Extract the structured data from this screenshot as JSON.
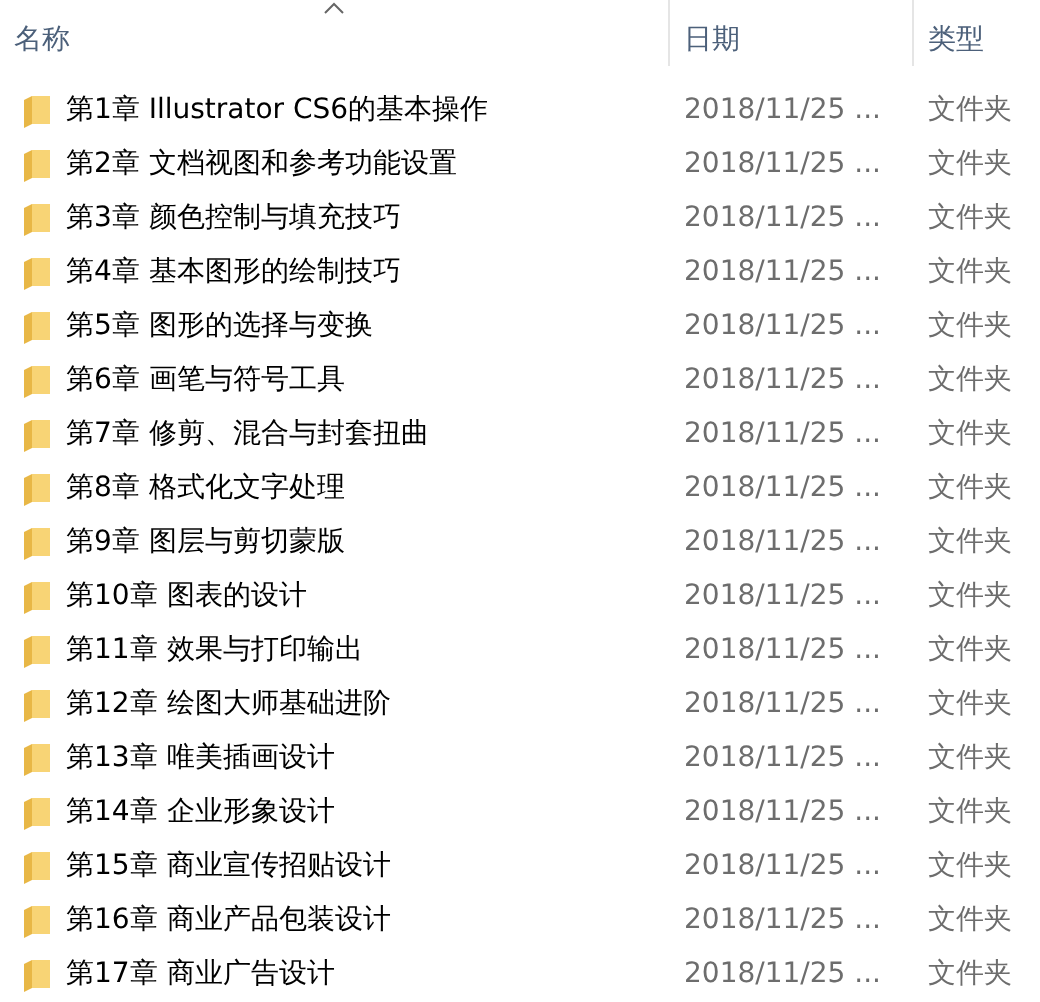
{
  "columns": [
    {
      "label": "名称",
      "sorted": true
    },
    {
      "label": "日期",
      "sorted": false
    },
    {
      "label": "类型",
      "sorted": false
    }
  ],
  "rows": [
    {
      "name": "第1章 Illustrator CS6的基本操作",
      "date": "2018/11/25 ...",
      "type": "文件夹"
    },
    {
      "name": "第2章 文档视图和参考功能设置",
      "date": "2018/11/25 ...",
      "type": "文件夹"
    },
    {
      "name": "第3章 颜色控制与填充技巧",
      "date": "2018/11/25 ...",
      "type": "文件夹"
    },
    {
      "name": "第4章 基本图形的绘制技巧",
      "date": "2018/11/25 ...",
      "type": "文件夹"
    },
    {
      "name": "第5章 图形的选择与变换",
      "date": "2018/11/25 ...",
      "type": "文件夹"
    },
    {
      "name": "第6章 画笔与符号工具",
      "date": "2018/11/25 ...",
      "type": "文件夹"
    },
    {
      "name": "第7章 修剪、混合与封套扭曲",
      "date": "2018/11/25 ...",
      "type": "文件夹"
    },
    {
      "name": "第8章 格式化文字处理",
      "date": "2018/11/25 ...",
      "type": "文件夹"
    },
    {
      "name": "第9章 图层与剪切蒙版",
      "date": "2018/11/25 ...",
      "type": "文件夹"
    },
    {
      "name": "第10章 图表的设计",
      "date": "2018/11/25 ...",
      "type": "文件夹"
    },
    {
      "name": "第11章 效果与打印输出",
      "date": "2018/11/25 ...",
      "type": "文件夹"
    },
    {
      "name": "第12章 绘图大师基础进阶",
      "date": "2018/11/25 ...",
      "type": "文件夹"
    },
    {
      "name": "第13章 唯美插画设计",
      "date": "2018/11/25 ...",
      "type": "文件夹"
    },
    {
      "name": "第14章 企业形象设计",
      "date": "2018/11/25 ...",
      "type": "文件夹"
    },
    {
      "name": "第15章 商业宣传招贴设计",
      "date": "2018/11/25 ...",
      "type": "文件夹"
    },
    {
      "name": "第16章 商业产品包装设计",
      "date": "2018/11/25 ...",
      "type": "文件夹"
    },
    {
      "name": "第17章 商业广告设计",
      "date": "2018/11/25 ...",
      "type": "文件夹"
    }
  ]
}
